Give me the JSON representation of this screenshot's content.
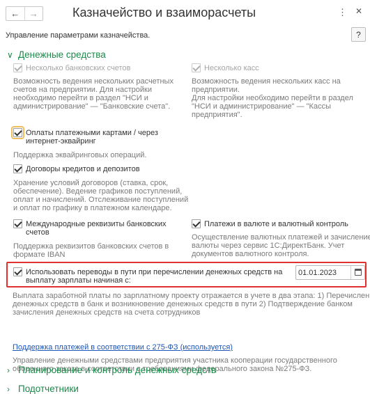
{
  "window": {
    "back_icon": "arrow-left-icon",
    "forward_icon": "arrow-right-icon",
    "title": "Казначейство и взаиморасчеты",
    "more_icon": "more-vertical-icon",
    "close_icon": "close-icon"
  },
  "subtitle": "Управление параметрами казначейства.",
  "help_label": "?",
  "sections": {
    "money": {
      "title": "Денежные средства",
      "expanded": true
    },
    "planning": {
      "title": "Планирование и контроль денежных средств",
      "expanded": false
    },
    "accountables": {
      "title": "Подотчетники",
      "expanded": false
    }
  },
  "options": {
    "bank_accounts": {
      "label": "Несколько банковских счетов",
      "checked": true,
      "enabled": false,
      "desc": [
        "Возможность ведения нескольких расчетных",
        "счетов на предприятии. Для настройки",
        "необходимо перейти в раздел \"НСИ и",
        "администрирование\" — \"Банковские счета\"."
      ]
    },
    "cash_desks": {
      "label": "Несколько касс",
      "checked": true,
      "enabled": false,
      "desc": [
        "Возможность ведения нескольких касс на",
        "предприятии.",
        "Для настройки необходимо перейти в раздел",
        "\"НСИ и администрирование\" — \"Кассы",
        "предприятия\"."
      ]
    },
    "card_payments": {
      "label_lines": [
        "Оплаты платежными картами / через",
        "интернет-эквайринг"
      ],
      "checked": true,
      "enabled": true,
      "desc": [
        "Поддержка эквайринговых операций."
      ]
    },
    "loans": {
      "label": "Договоры кредитов и депозитов",
      "checked": true,
      "enabled": true,
      "desc": [
        "Хранение условий договоров (ставка, срок,",
        "обеспечение). Ведение графиков поступлений,",
        "оплат и начислений. Отслеживание поступлений",
        "и оплат по графику в платежном календаре."
      ]
    },
    "intl_details": {
      "label_lines": [
        "Международные реквизиты банковских",
        "счетов"
      ],
      "checked": true,
      "enabled": true,
      "desc": [
        "Поддержка реквизитов банковских счетов в",
        "формате IBAN"
      ]
    },
    "currency": {
      "label": "Платежи в валюте и валютный контроль",
      "checked": true,
      "enabled": true,
      "desc": [
        "Осуществление валютных платежей и зачисление",
        "валюты через сервис 1С:ДиректБанк. Учет",
        "документов валютного контроля."
      ]
    },
    "transfers_in_transit": {
      "label_lines": [
        "Использовать переводы в пути при перечислении денежных средств на",
        "выплату зарплаты начиная с:"
      ],
      "checked": true,
      "enabled": true,
      "date_value": "01.01.2023",
      "date_icon": "calendar-icon",
      "desc": [
        "Выплата заработной платы по зарплатному проекту отражается в учете в два этапа: 1) Перечисление",
        "денежных средств в банк и возникновение денежных средств в пути 2) Подтверждение банком",
        "зачисления денежных средств на счета сотрудников"
      ]
    }
  },
  "law_275": {
    "link": "Поддержка платежей в соответствии с 275-ФЗ (используется)",
    "desc": [
      "Управление денежными средствами предприятия участника кооперации государственного",
      "оборонного заказа в соответствии с требованиями федерального закона №275-ФЗ."
    ]
  },
  "colors": {
    "section_green": "#1a8a4a",
    "link_blue": "#1b56b8",
    "highlight_red": "#e0312f",
    "desc_gray": "#7a7a7a"
  }
}
